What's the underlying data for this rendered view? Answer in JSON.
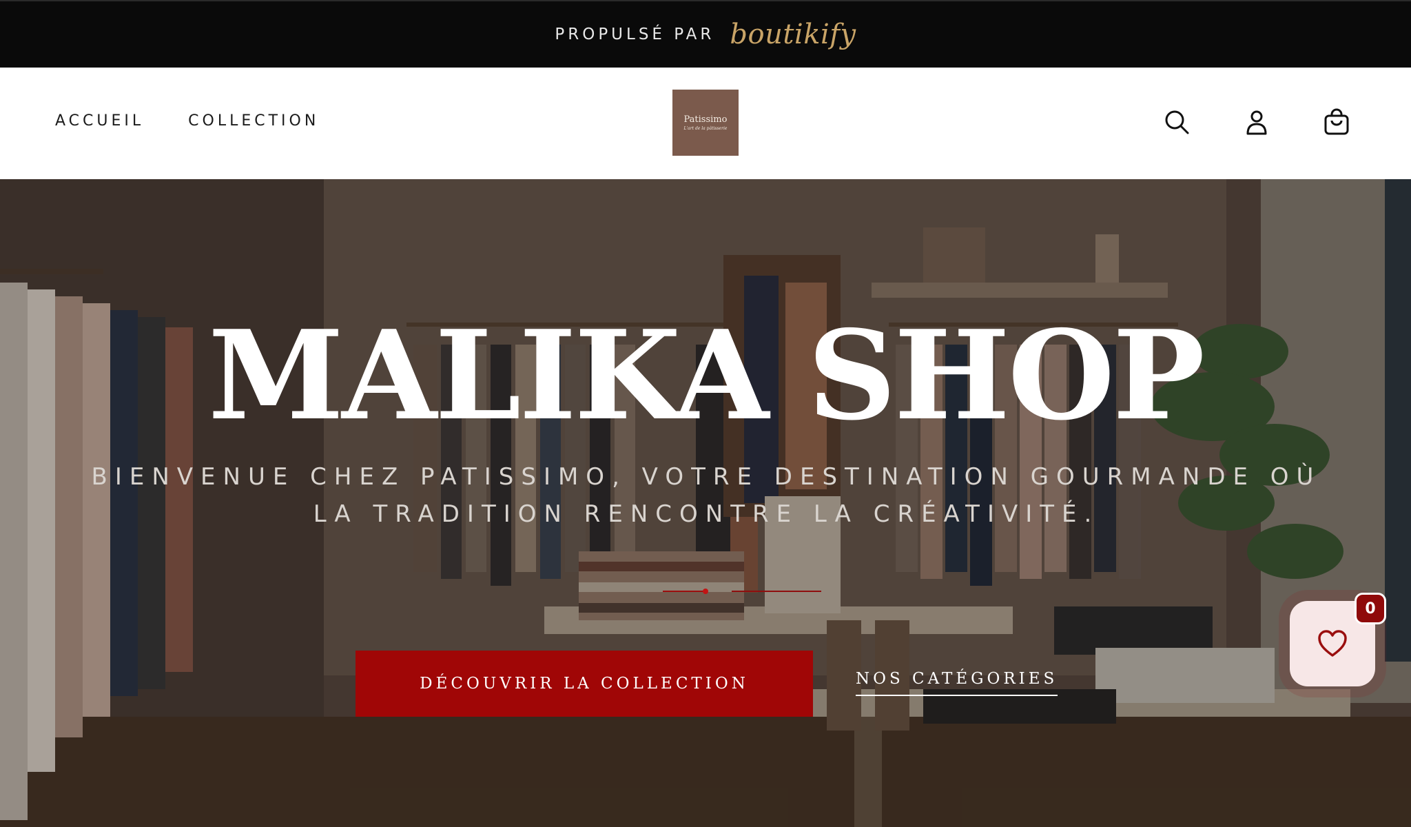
{
  "announcement": {
    "powered_by": "PROPULSÉ PAR",
    "brand": "boutikify"
  },
  "nav": {
    "items": [
      {
        "label": "ACCUEIL"
      },
      {
        "label": "COLLECTION"
      }
    ]
  },
  "logo": {
    "title": "Patissimo",
    "tagline": "L'art de la pâtisserie"
  },
  "header_icons": [
    "search-icon",
    "account-icon",
    "cart-icon"
  ],
  "hero": {
    "title": "MALIKA SHOP",
    "subtitle": "BIENVENUE CHEZ PATISSIMO, VOTRE DESTINATION GOURMANDE OÙ LA TRADITION RENCONTRE LA CRÉATIVITÉ.",
    "primary_button": "DÉCOUVRIR LA COLLECTION",
    "secondary_link": "NOS CATÉGORIES"
  },
  "wishlist": {
    "icon": "heart-icon",
    "count": "0"
  },
  "colors": {
    "topbar_bg": "#0a0a0a",
    "brand_gold": "#c9a467",
    "primary_red": "#a00606",
    "logo_brown": "#7b5a4c",
    "wishlist_bg": "#f7e7e7"
  }
}
